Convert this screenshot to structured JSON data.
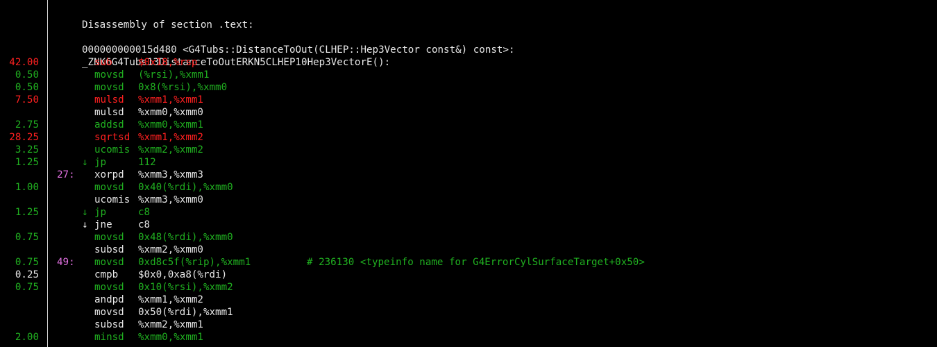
{
  "header": {
    "section_title": "Disassembly of section .text:",
    "symbol_line": "000000000015d480 <G4Tubs::DistanceToOut(CLHEP::Hep3Vector const&) const>:",
    "mangled_line": "_ZNK6G4Tubs13DistanceToOutERKN5CLHEP10Hep3VectorE():"
  },
  "colors": {
    "hot": "#ff2020",
    "warm": "#20b020",
    "plain": "#e8e8e8",
    "label": "#e070e0"
  },
  "lines": [
    {
      "pct": "42.00",
      "label": "",
      "arrow": "",
      "mnemonic": "sub",
      "operands": "$0x18,%rsp",
      "comment": "",
      "heat": "hot"
    },
    {
      "pct": "0.50",
      "label": "",
      "arrow": "",
      "mnemonic": "movsd",
      "operands": "(%rsi),%xmm1",
      "comment": "",
      "heat": "warm"
    },
    {
      "pct": "0.50",
      "label": "",
      "arrow": "",
      "mnemonic": "movsd",
      "operands": "0x8(%rsi),%xmm0",
      "comment": "",
      "heat": "warm"
    },
    {
      "pct": "7.50",
      "label": "",
      "arrow": "",
      "mnemonic": "mulsd",
      "operands": "%xmm1,%xmm1",
      "comment": "",
      "heat": "hot"
    },
    {
      "pct": "",
      "label": "",
      "arrow": "",
      "mnemonic": "mulsd",
      "operands": "%xmm0,%xmm0",
      "comment": "",
      "heat": "plain"
    },
    {
      "pct": "2.75",
      "label": "",
      "arrow": "",
      "mnemonic": "addsd",
      "operands": "%xmm0,%xmm1",
      "comment": "",
      "heat": "warm"
    },
    {
      "pct": "28.25",
      "label": "",
      "arrow": "",
      "mnemonic": "sqrtsd",
      "operands": "%xmm1,%xmm2",
      "comment": "",
      "heat": "hot"
    },
    {
      "pct": "3.25",
      "label": "",
      "arrow": "",
      "mnemonic": "ucomis",
      "operands": "%xmm2,%xmm2",
      "comment": "",
      "heat": "warm"
    },
    {
      "pct": "1.25",
      "label": "",
      "arrow": "↓",
      "mnemonic": "jp",
      "operands": "112",
      "comment": "",
      "heat": "warm"
    },
    {
      "pct": "",
      "label": "27:",
      "arrow": "",
      "mnemonic": "xorpd",
      "operands": "%xmm3,%xmm3",
      "comment": "",
      "heat": "plain"
    },
    {
      "pct": "1.00",
      "label": "",
      "arrow": "",
      "mnemonic": "movsd",
      "operands": "0x40(%rdi),%xmm0",
      "comment": "",
      "heat": "warm"
    },
    {
      "pct": "",
      "label": "",
      "arrow": "",
      "mnemonic": "ucomis",
      "operands": "%xmm3,%xmm0",
      "comment": "",
      "heat": "plain"
    },
    {
      "pct": "1.25",
      "label": "",
      "arrow": "↓",
      "mnemonic": "jp",
      "operands": "c8",
      "comment": "",
      "heat": "warm"
    },
    {
      "pct": "",
      "label": "",
      "arrow": "↓",
      "mnemonic": "jne",
      "operands": "c8",
      "comment": "",
      "heat": "plain"
    },
    {
      "pct": "0.75",
      "label": "",
      "arrow": "",
      "mnemonic": "movsd",
      "operands": "0x48(%rdi),%xmm0",
      "comment": "",
      "heat": "warm"
    },
    {
      "pct": "",
      "label": "",
      "arrow": "",
      "mnemonic": "subsd",
      "operands": "%xmm2,%xmm0",
      "comment": "",
      "heat": "plain"
    },
    {
      "pct": "0.75",
      "label": "49:",
      "arrow": "",
      "mnemonic": "movsd",
      "operands": "0xd8c5f(%rip),%xmm1",
      "comment": "# 236130 <typeinfo name for G4ErrorCylSurfaceTarget+0x50>",
      "heat": "warm"
    },
    {
      "pct": "0.25",
      "label": "",
      "arrow": "",
      "mnemonic": "cmpb",
      "operands": "$0x0,0xa8(%rdi)",
      "comment": "",
      "heat": "plain"
    },
    {
      "pct": "0.75",
      "label": "",
      "arrow": "",
      "mnemonic": "movsd",
      "operands": "0x10(%rsi),%xmm2",
      "comment": "",
      "heat": "warm"
    },
    {
      "pct": "",
      "label": "",
      "arrow": "",
      "mnemonic": "andpd",
      "operands": "%xmm1,%xmm2",
      "comment": "",
      "heat": "plain"
    },
    {
      "pct": "",
      "label": "",
      "arrow": "",
      "mnemonic": "movsd",
      "operands": "0x50(%rdi),%xmm1",
      "comment": "",
      "heat": "plain"
    },
    {
      "pct": "",
      "label": "",
      "arrow": "",
      "mnemonic": "subsd",
      "operands": "%xmm2,%xmm1",
      "comment": "",
      "heat": "plain"
    },
    {
      "pct": "2.00",
      "label": "",
      "arrow": "",
      "mnemonic": "minsd",
      "operands": "%xmm0,%xmm1",
      "comment": "",
      "heat": "warm"
    }
  ]
}
